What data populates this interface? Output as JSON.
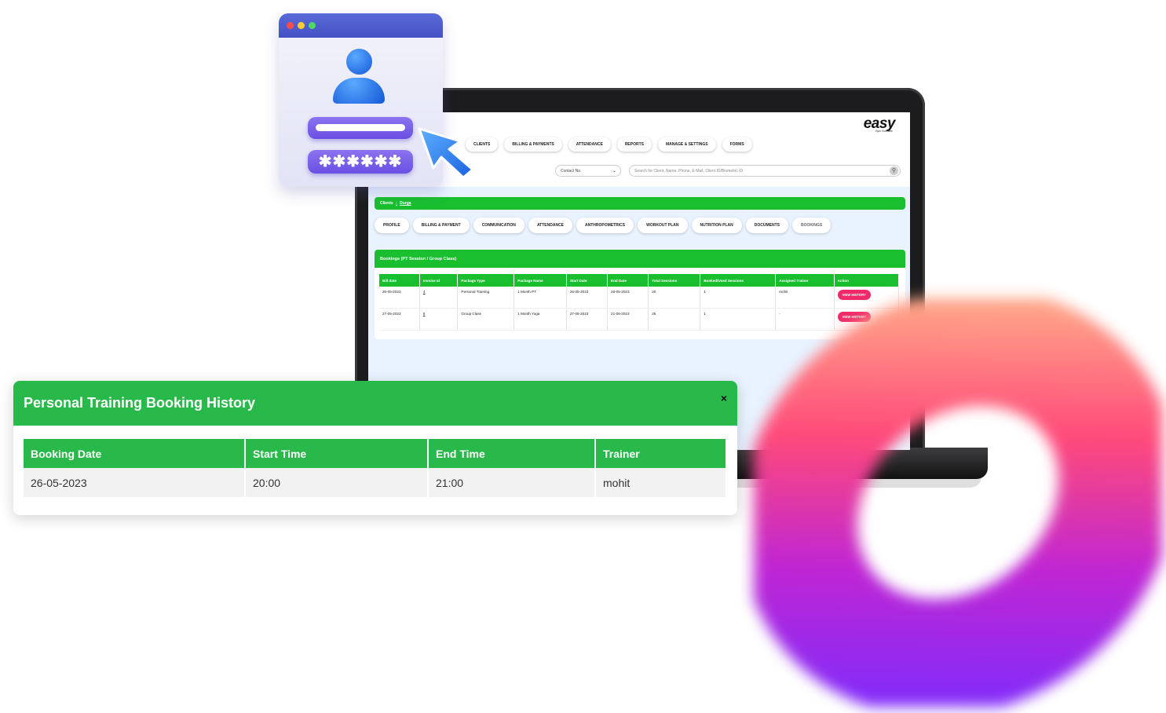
{
  "app": {
    "logo": "easy",
    "logo_sub": "Gym Software",
    "top_nav": [
      "CLIENTS",
      "BILLING & PAYMENTS",
      "ATTENDANCE",
      "REPORTS",
      "MANAGE & SETTINGS",
      "FORMS"
    ],
    "contact_select": "Contact No.",
    "search_placeholder": "Search for Client, Name, Phone, E-Mail, Client ID/Biometric ID",
    "breadcrumb": {
      "root": "Clients",
      "separator": ":",
      "current": "Durga"
    },
    "client_tabs": [
      "PROFILE",
      "BILLING & PAYMENT",
      "COMMUNICATION",
      "ATTENDANCE",
      "ANTHROPOMETRICS",
      "WORKOUT PLAN",
      "NUTRITION PLAN",
      "DOCUMENTS",
      "BOOKINGS"
    ],
    "bookings": {
      "title": "Bookings (PT Session / Group Class)",
      "columns": [
        "Bill date",
        "Invoice Id",
        "Package Type",
        "Package Name",
        "Start Date",
        "End Date",
        "Total Sessions",
        "Booked/Used Sessions",
        "Assigned Trainer",
        "Action"
      ],
      "rows": [
        {
          "bill_date": "26-05-2023",
          "invoice_id": "4",
          "package_type": "Personal Training",
          "package_name": "1 Month PT",
          "start_date": "26-05-2023",
          "end_date": "26-05-2023",
          "total_sessions": "20",
          "booked_sessions": "1",
          "trainer": "mohit",
          "action": "VIEW HISTORY"
        },
        {
          "bill_date": "27-05-2023",
          "invoice_id": "5",
          "package_type": "Group Class",
          "package_name": "1 Month Yoga",
          "start_date": "27-05-2023",
          "end_date": "21-06-2023",
          "total_sessions": "25",
          "booked_sessions": "1",
          "trainer": "-",
          "action": "VIEW HISTORY"
        }
      ]
    }
  },
  "login_card": {
    "password_mask": "✱✱✱✱✱✱",
    "window_dots": [
      "#ff4b4b",
      "#ffcc33",
      "#4cd964"
    ]
  },
  "modal": {
    "title": "Personal Training Booking History",
    "close_label": "×",
    "columns": [
      "Booking Date",
      "Start Time",
      "End Time",
      "Trainer"
    ],
    "rows": [
      {
        "booking_date": "26-05-2023",
        "start_time": "20:00",
        "end_time": "21:00",
        "trainer": "mohit"
      }
    ]
  },
  "colors": {
    "brand_green": "#19bf2f",
    "modal_green": "#29b94a",
    "action_pink": "#f02a6a"
  }
}
